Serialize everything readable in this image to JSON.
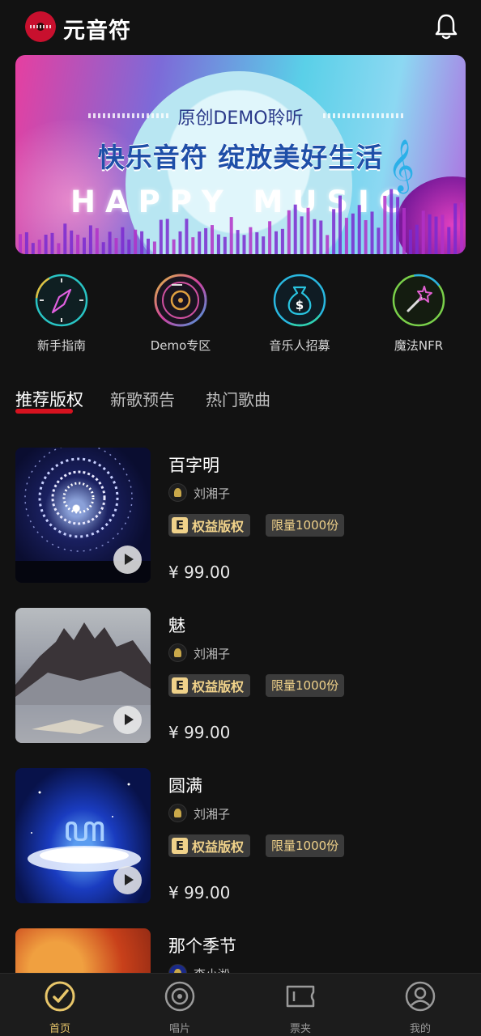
{
  "header": {
    "app_name": "元音符"
  },
  "banner": {
    "subtitle": "原创DEMO聆听",
    "title": "快乐音符 绽放美好生活",
    "english": "HAPPY MUSIC"
  },
  "shortcuts": [
    {
      "label": "新手指南",
      "icon": "compass-icon",
      "color": "#29c4c4"
    },
    {
      "label": "Demo专区",
      "icon": "vinyl-record-icon",
      "color": "#e0a040"
    },
    {
      "label": "音乐人招募",
      "icon": "money-bag-icon",
      "color": "#29b8e0"
    },
    {
      "label": "魔法NFR",
      "icon": "magic-wand-icon",
      "color": "#7ad04a"
    }
  ],
  "tabs": [
    {
      "label": "推荐版权",
      "active": true
    },
    {
      "label": "新歌预告",
      "active": false
    },
    {
      "label": "热门歌曲",
      "active": false
    }
  ],
  "songs": [
    {
      "title": "百字明",
      "artist": "刘湘子",
      "badge_letter": "E",
      "badge_text": "权益版权",
      "limit": "限量1000份",
      "price": "¥ 99.00"
    },
    {
      "title": "魅",
      "artist": "刘湘子",
      "badge_letter": "E",
      "badge_text": "权益版权",
      "limit": "限量1000份",
      "price": "¥ 99.00"
    },
    {
      "title": "圆满",
      "artist": "刘湘子",
      "badge_letter": "E",
      "badge_text": "权益版权",
      "limit": "限量1000份",
      "price": "¥ 99.00"
    },
    {
      "title": "那个季节",
      "artist": "李小淞"
    }
  ],
  "bottom_nav": [
    {
      "label": "首页",
      "icon": "home-disc-icon",
      "active": true
    },
    {
      "label": "唱片",
      "icon": "record-icon",
      "active": false
    },
    {
      "label": "票夹",
      "icon": "ticket-icon",
      "active": false
    },
    {
      "label": "我的",
      "icon": "profile-icon",
      "active": false
    }
  ],
  "colors": {
    "accent_red": "#d6121f",
    "gold": "#e8c66a",
    "background": "#121212"
  }
}
